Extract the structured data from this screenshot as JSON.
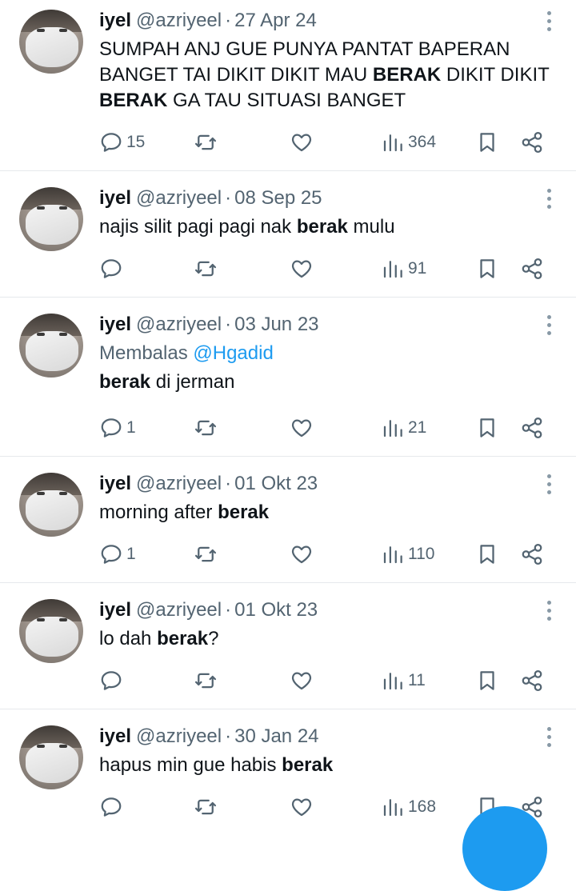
{
  "tweets": [
    {
      "name": "iyel",
      "handle": "@azriyeel",
      "date": "27 Apr 24",
      "text_parts": [
        "SUMPAH ANJ GUE PUNYA PANTAT BAPERAN BANGET TAI DIKIT DIKIT MAU ",
        "BERAK",
        " DIKIT DIKIT ",
        "BERAK",
        " GA TAU SITUASI BANGET"
      ],
      "replies": "15",
      "views": "364"
    },
    {
      "name": "iyel",
      "handle": "@azriyeel",
      "date": "08 Sep 25",
      "text_parts": [
        "najis silit pagi pagi nak ",
        "berak",
        " mulu"
      ],
      "replies": "",
      "views": "91"
    },
    {
      "name": "iyel",
      "handle": "@azriyeel",
      "date": "03 Jun 23",
      "reply_label": "Membalas",
      "reply_mention": "@Hgadid",
      "text_parts": [
        "berak",
        " di jerman"
      ],
      "replies": "1",
      "views": "21"
    },
    {
      "name": "iyel",
      "handle": "@azriyeel",
      "date": "01 Okt 23",
      "text_parts": [
        "morning after ",
        "berak"
      ],
      "replies": "1",
      "views": "110"
    },
    {
      "name": "iyel",
      "handle": "@azriyeel",
      "date": "01 Okt 23",
      "text_parts": [
        "lo dah ",
        "berak",
        "?"
      ],
      "replies": "",
      "views": "11"
    },
    {
      "name": "iyel",
      "handle": "@azriyeel",
      "date": "30 Jan 24",
      "text_parts": [
        "hapus min gue habis ",
        "berak"
      ],
      "replies": "",
      "views": "168"
    }
  ],
  "icons": {
    "reply": "reply-icon",
    "retweet": "retweet-icon",
    "like": "heart-icon",
    "views": "views-icon",
    "bookmark": "bookmark-icon",
    "share": "share-icon",
    "more": "more-vertical-icon"
  },
  "colors": {
    "accent": "#1d9bf0",
    "muted": "#536471",
    "text": "#0f1419",
    "divider": "#e6e9ec"
  }
}
